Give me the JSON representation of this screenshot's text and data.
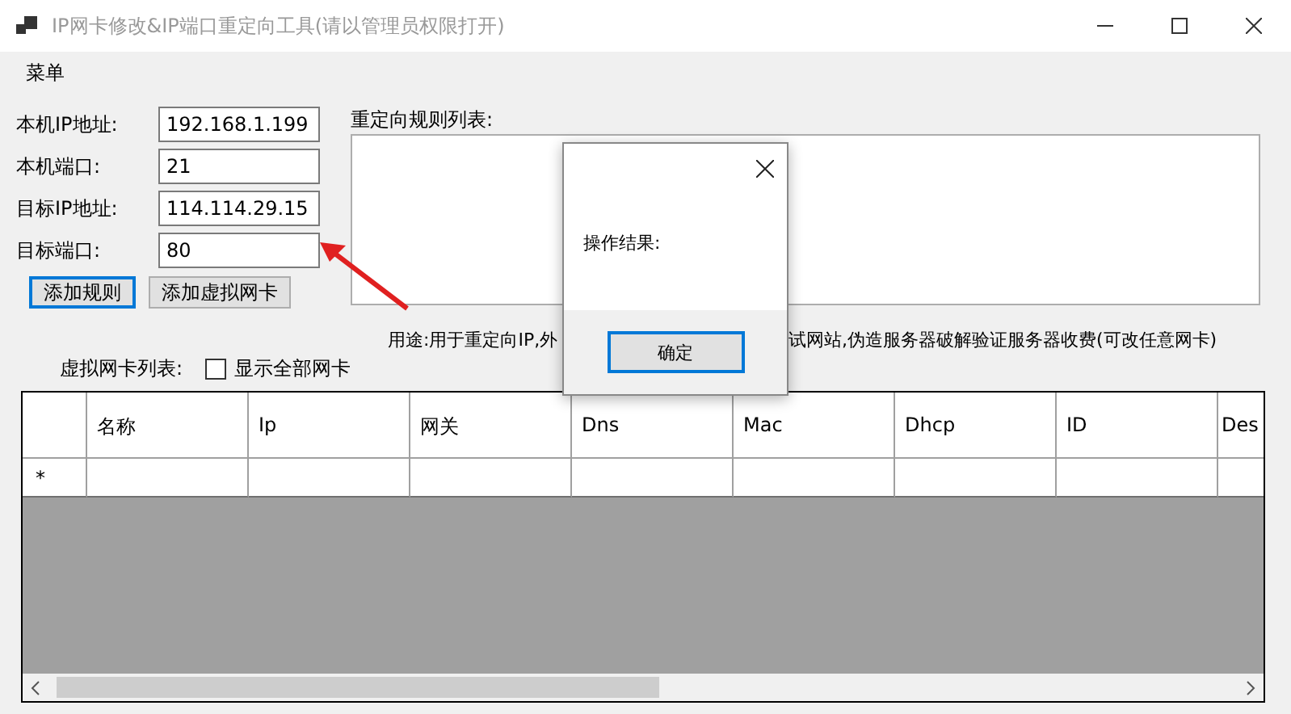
{
  "window": {
    "title": "IP网卡修改&IP端口重定向工具(请以管理员权限打开)"
  },
  "menu": [
    "菜单"
  ],
  "fields": [
    {
      "label": "本机IP地址:",
      "value": "192.168.1.199"
    },
    {
      "label": "本机端口:",
      "value": "21"
    },
    {
      "label": "目标IP地址:",
      "value": "114.114.29.15"
    },
    {
      "label": "目标端口:",
      "value": "80"
    }
  ],
  "buttons": [
    {
      "label": "添加规则",
      "focused": true
    },
    {
      "label": "添加虚拟网卡",
      "focused": false
    }
  ],
  "rules_group": {
    "title": "重定向规则列表:"
  },
  "description": [
    "用途:用于重定向IP,外",
    "试网站,伪造服务器破解验证服务器收费(可改任意网卡)"
  ],
  "adapter_list": {
    "label": "虚拟网卡列表:",
    "show_all": {
      "label": "显示全部网卡",
      "checked": false
    }
  },
  "grid": {
    "columns": [
      "名称",
      "Ip",
      "网关",
      "Dns",
      "Mac",
      "Dhcp",
      "ID",
      "Des"
    ],
    "new_row_marker": "*"
  },
  "dialog": {
    "message": "操作结果:",
    "button": "确定"
  }
}
